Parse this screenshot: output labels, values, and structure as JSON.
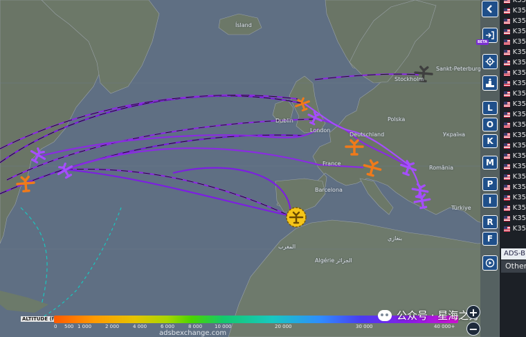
{
  "places": {
    "iceland": "Ísland",
    "dublin": "Dublin",
    "london": "London",
    "france": "France",
    "barcelona": "Barcelona",
    "deutschland": "Deutschland",
    "stockholm": "Stockholm",
    "sankt_peterburg": "Sankt-Peterburg",
    "polska": "Polska",
    "ukraine": "Україна",
    "romania": "România",
    "turkiye": "Türkiye",
    "algeria": "Algérie الجزائر",
    "morocco": "المغرب",
    "bnel": "بنغازي"
  },
  "controls": {
    "collapse_icon": "chevron-left-icon",
    "login_icon": "sign-in-icon",
    "beta_badge": "BETA",
    "settings_icon": "gear-icon",
    "stats_icon": "podium-icon",
    "letters": [
      "L",
      "O",
      "K",
      "M",
      "P",
      "I",
      "R",
      "F"
    ],
    "replay_icon": "play-circle-icon"
  },
  "aircraft_list": {
    "callsign_prefix": "K35",
    "flag": "us-flag",
    "row_count": 23
  },
  "source_filter": {
    "selected": "ADS-B",
    "other": "Other"
  },
  "legend": {
    "title": "ALTITUDE (ft)",
    "ticks": [
      "0",
      "500",
      "1 000",
      "2 000",
      "4 000",
      "6 000",
      "8 000",
      "10 000",
      "20 000",
      "30 000",
      "40 000+"
    ],
    "low_color": "#ff5a00",
    "high_color": "#d011d0"
  },
  "attribution": "adsbexchange.com",
  "watermark": "公众号 · 星海之刃",
  "zoom": {
    "in": "+",
    "out": "−"
  },
  "colors": {
    "track_high": "#8a2be2",
    "track_mid": "#7c1fe0",
    "track_dash": "#1a1a1a",
    "plane_orange": "#f07a1a",
    "plane_violet": "#a64dff",
    "plane_selected": "#f5c518",
    "control_blue": "#1f4f8a"
  }
}
